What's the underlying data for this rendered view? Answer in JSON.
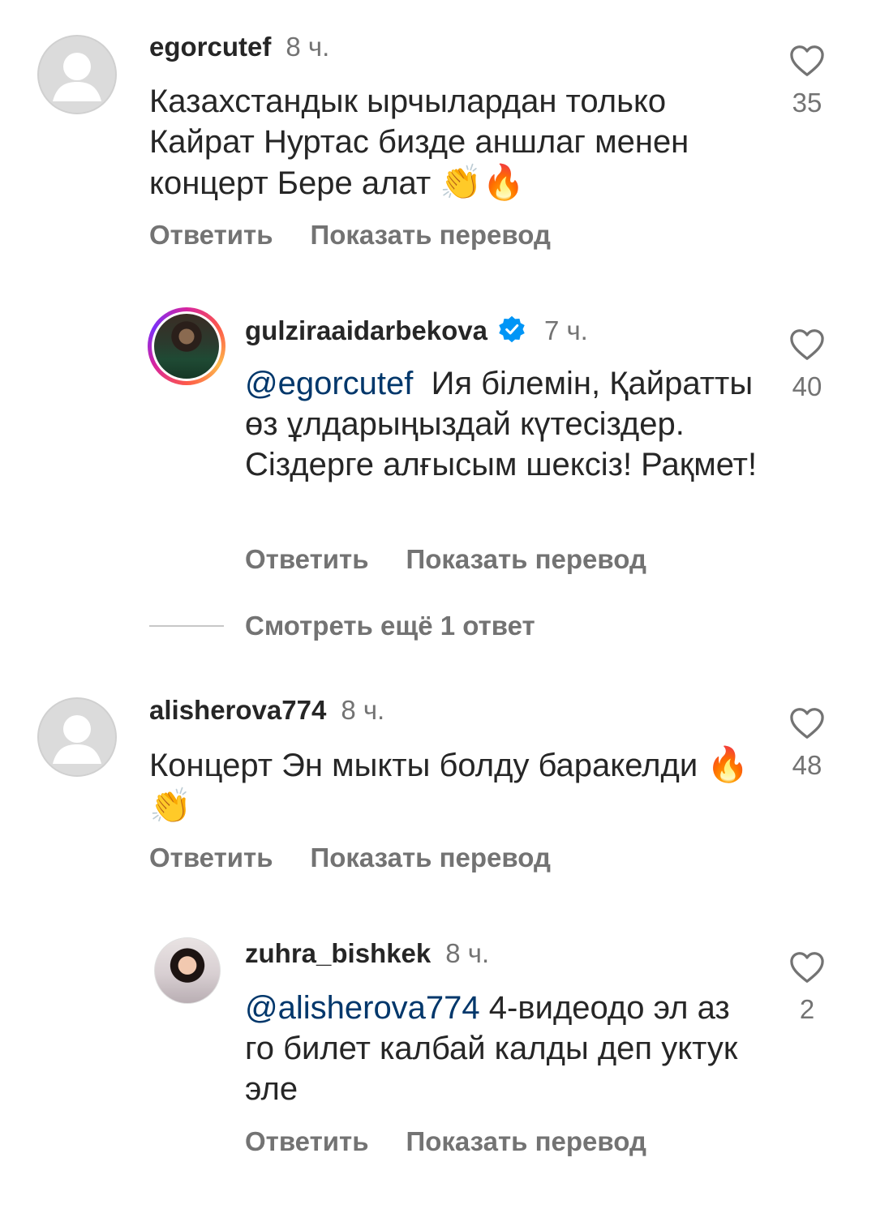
{
  "comments": [
    {
      "username": "egorcutef",
      "time": "8 ч.",
      "text": "Казахстандык ырчылардан только Кайрат Нуртас бизде аншлаг менен концерт Бере алат",
      "emoji": "👏🔥",
      "likes": "35",
      "reply_label": "Ответить",
      "translate_label": "Показать перевод",
      "icon": "default-avatar-icon"
    },
    {
      "username": "gulziraaidarbekova",
      "time": "7 ч.",
      "mention": "@egorcutef",
      "text": "Ия білемін, Қайратты өз ұлдарыңыздай күтесіздер. Сіздерге алғысым шексіз! Рақмет!",
      "likes": "40",
      "reply_label": "Ответить",
      "translate_label": "Показать перевод",
      "verified_icon": "verified-badge-icon",
      "badge_color": "#0095f6"
    },
    {
      "username": "alisherova774",
      "time": "8 ч.",
      "text": "Концерт Эн мыкты болду баракелди",
      "emoji": "🔥👏",
      "likes": "48",
      "reply_label": "Ответить",
      "translate_label": "Показать перевод",
      "icon": "default-avatar-icon"
    },
    {
      "username": "zuhra_bishkek",
      "time": "8 ч.",
      "mention": "@alisherova774",
      "text": "4-видеодо эл аз го билет калбай калды деп уктук эле",
      "likes": "2",
      "reply_label": "Ответить",
      "translate_label": "Показать перевод"
    }
  ],
  "view_more_replies": "Смотреть ещё 1 ответ",
  "colors": {
    "text": "#262626",
    "secondary": "#737373",
    "mention": "#00376b",
    "verified": "#0095f6"
  }
}
